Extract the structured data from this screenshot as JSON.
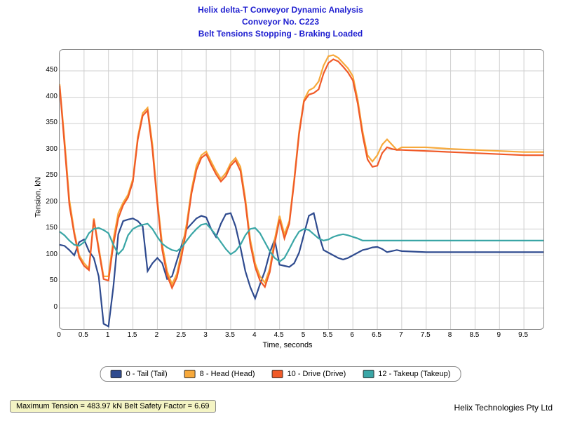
{
  "title": {
    "line1": "Helix delta-T Conveyor Dynamic Analysis",
    "line2": "Conveyor No. C223",
    "line3": "Belt Tensions Stopping - Braking Loaded"
  },
  "axes": {
    "ylabel": "Tension, kN",
    "xlabel": "Time, seconds",
    "yticks": [
      0,
      50,
      100,
      150,
      200,
      250,
      300,
      350,
      400,
      450
    ],
    "xticks": [
      0,
      0.5,
      1,
      1.5,
      2,
      2.5,
      3,
      3.5,
      4,
      4.5,
      5,
      5.5,
      6,
      6.5,
      7,
      7.5,
      8,
      8.5,
      9,
      9.5
    ],
    "xlim": [
      0,
      9.9
    ],
    "ylim": [
      -40,
      490
    ]
  },
  "legend": [
    {
      "label": "0 - Tail (Tail)",
      "color": "#2f4b8f"
    },
    {
      "label": "8 - Head (Head)",
      "color": "#f7a93b"
    },
    {
      "label": "10 - Drive (Drive)",
      "color": "#f05a28"
    },
    {
      "label": "12 - Takeup (Takeup)",
      "color": "#3aa6a6"
    }
  ],
  "status_text": "Maximum Tension = 483.97 kN Belt Safety Factor = 6.69",
  "company": "Helix Technologies Pty Ltd",
  "chart_data": {
    "type": "line",
    "title": "Belt Tensions Stopping - Braking Loaded",
    "xlabel": "Time, seconds",
    "ylabel": "Tension, kN",
    "xlim": [
      0,
      9.9
    ],
    "ylim": [
      -40,
      490
    ],
    "x": [
      0,
      0.1,
      0.2,
      0.3,
      0.4,
      0.5,
      0.6,
      0.7,
      0.8,
      0.9,
      1.0,
      1.1,
      1.2,
      1.3,
      1.4,
      1.5,
      1.6,
      1.7,
      1.8,
      1.9,
      2.0,
      2.1,
      2.2,
      2.3,
      2.4,
      2.5,
      2.6,
      2.7,
      2.8,
      2.9,
      3.0,
      3.1,
      3.2,
      3.3,
      3.4,
      3.5,
      3.6,
      3.7,
      3.8,
      3.9,
      4.0,
      4.1,
      4.2,
      4.3,
      4.4,
      4.5,
      4.6,
      4.7,
      4.8,
      4.9,
      5.0,
      5.1,
      5.2,
      5.3,
      5.4,
      5.5,
      5.6,
      5.7,
      5.8,
      5.9,
      6.0,
      6.1,
      6.2,
      6.3,
      6.4,
      6.5,
      6.6,
      6.7,
      6.8,
      6.9,
      7.0,
      7.5,
      8.0,
      8.5,
      9.0,
      9.5,
      9.9
    ],
    "series": [
      {
        "name": "0 - Tail (Tail)",
        "color": "#2f4b8f",
        "values": [
          120,
          118,
          110,
          100,
          125,
          130,
          108,
          95,
          60,
          -30,
          -35,
          40,
          140,
          165,
          168,
          170,
          165,
          155,
          70,
          85,
          95,
          85,
          55,
          60,
          90,
          120,
          150,
          160,
          170,
          175,
          172,
          150,
          135,
          160,
          178,
          180,
          155,
          115,
          70,
          40,
          18,
          45,
          70,
          105,
          130,
          82,
          80,
          78,
          85,
          105,
          140,
          175,
          180,
          140,
          110,
          105,
          100,
          95,
          92,
          95,
          100,
          105,
          110,
          112,
          115,
          116,
          112,
          106,
          108,
          110,
          108,
          106,
          106,
          106,
          106,
          106,
          106
        ]
      },
      {
        "name": "8 - Head (Head)",
        "color": "#f7a93b",
        "values": [
          425,
          320,
          205,
          145,
          100,
          85,
          75,
          170,
          115,
          60,
          60,
          130,
          180,
          200,
          215,
          245,
          325,
          370,
          380,
          310,
          205,
          120,
          70,
          45,
          65,
          110,
          160,
          225,
          270,
          290,
          297,
          278,
          260,
          245,
          256,
          275,
          285,
          268,
          208,
          130,
          85,
          60,
          48,
          75,
          130,
          175,
          140,
          165,
          245,
          335,
          395,
          413,
          418,
          430,
          460,
          478,
          480,
          475,
          465,
          455,
          440,
          395,
          335,
          290,
          278,
          290,
          310,
          320,
          310,
          300,
          305,
          305,
          302,
          300,
          298,
          296,
          296
        ]
      },
      {
        "name": "10 - Drive (Drive)",
        "color": "#f05a28",
        "values": [
          422,
          310,
          195,
          140,
          96,
          80,
          72,
          168,
          110,
          55,
          52,
          120,
          170,
          195,
          210,
          240,
          320,
          365,
          375,
          300,
          198,
          110,
          62,
          38,
          58,
          100,
          152,
          218,
          262,
          285,
          292,
          272,
          254,
          240,
          250,
          270,
          280,
          260,
          200,
          122,
          78,
          52,
          40,
          68,
          122,
          168,
          132,
          160,
          240,
          330,
          392,
          405,
          408,
          415,
          445,
          465,
          472,
          468,
          458,
          447,
          432,
          388,
          328,
          282,
          268,
          270,
          294,
          305,
          302,
          300,
          300,
          298,
          296,
          294,
          292,
          290,
          290
        ]
      },
      {
        "name": "12 - Takeup (Takeup)",
        "color": "#3aa6a6",
        "values": [
          145,
          138,
          128,
          120,
          118,
          125,
          142,
          150,
          152,
          148,
          142,
          120,
          102,
          112,
          138,
          150,
          155,
          158,
          160,
          150,
          135,
          122,
          115,
          110,
          108,
          115,
          128,
          140,
          150,
          158,
          160,
          150,
          138,
          125,
          112,
          102,
          108,
          120,
          138,
          150,
          152,
          142,
          125,
          108,
          95,
          88,
          95,
          112,
          130,
          145,
          150,
          148,
          140,
          132,
          128,
          130,
          135,
          138,
          140,
          138,
          135,
          132,
          128,
          128,
          128,
          128,
          128,
          128,
          128,
          128,
          128,
          128,
          128,
          128,
          128,
          128,
          128
        ]
      }
    ]
  }
}
